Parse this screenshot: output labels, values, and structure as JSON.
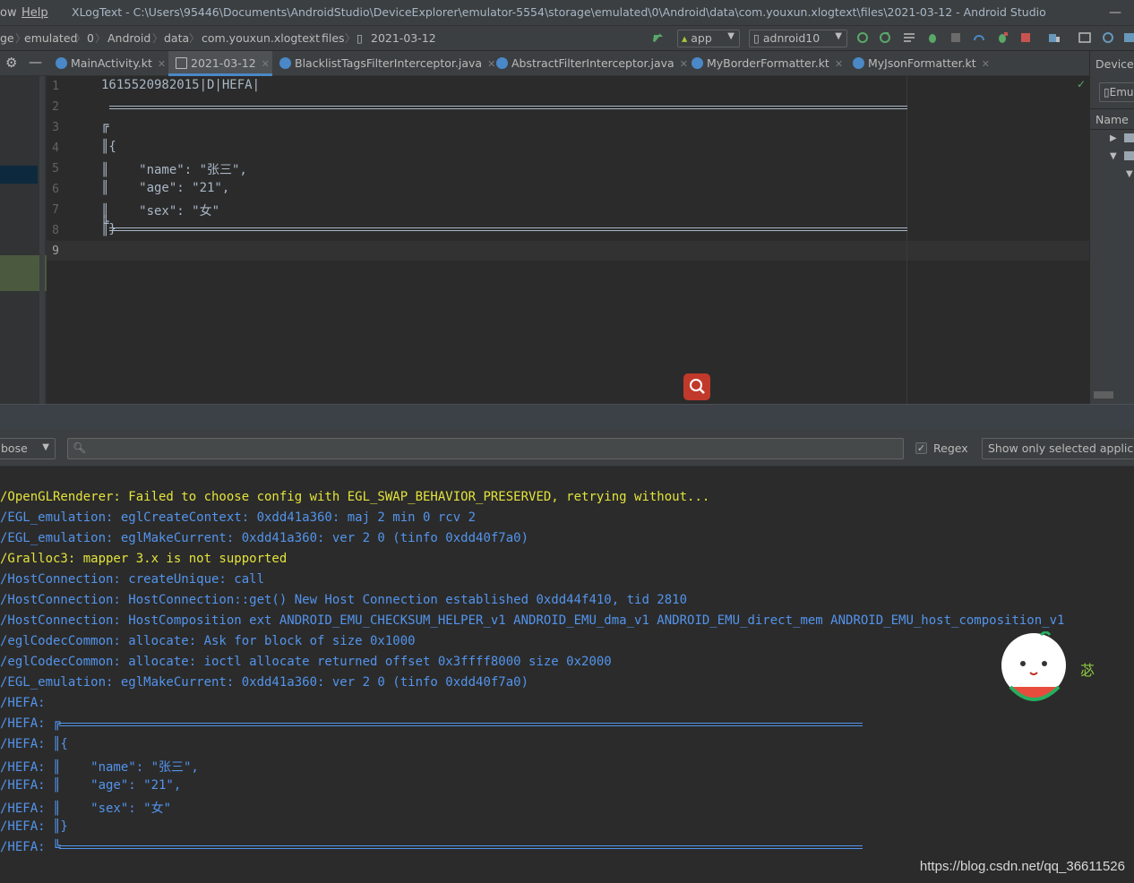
{
  "titlebar": {
    "menu_items": [
      "ow",
      "Help"
    ],
    "title": "XLogText - C:\\Users\\95446\\Documents\\AndroidStudio\\DeviceExplorer\\emulator-5554\\storage\\emulated\\0\\Android\\data\\com.youxun.xlogtext\\files\\2021-03-12 - Android Studio",
    "minimize": "—"
  },
  "breadcrumbs": [
    "ge",
    "emulated",
    "0",
    "Android",
    "data",
    "com.youxun.xlogtext",
    "files",
    "2021-03-12"
  ],
  "toolbar": {
    "run_config": "app",
    "device": "adnroid10"
  },
  "tabs": [
    {
      "label": "MainActivity.kt"
    },
    {
      "label": "2021-03-12"
    },
    {
      "label": "BlacklistTagsFilterInterceptor.java"
    },
    {
      "label": "AbstractFilterInterceptor.java"
    },
    {
      "label": "MyBorderFormatter.kt"
    },
    {
      "label": "MyJsonFormatter.kt"
    }
  ],
  "right_panel": {
    "title": "Device",
    "emu_button": "Emu",
    "column_header": "Name"
  },
  "editor": {
    "line_numbers": [
      "1",
      "2",
      "3",
      "4",
      "5",
      "6",
      "7",
      "8",
      "9"
    ],
    "lines": [
      "1615520982015|D|HEFA|",
      "",
      "╔",
      "║{",
      "║    \"name\": \"张三\",",
      "║    \"age\": \"21\",",
      "║    \"sex\": \"女\"",
      "║}",
      "╚"
    ]
  },
  "logcat": {
    "level": "bose",
    "search_placeholder": "",
    "regex_label": "Regex",
    "filter_option": "Show only selected applicati"
  },
  "log_lines": [
    {
      "text": "/OpenGLRenderer: Failed to choose config with EGL_SWAP_BEHAVIOR_PRESERVED, retrying without...",
      "level": "warn"
    },
    {
      "text": "/EGL_emulation: eglCreateContext: 0xdd41a360: maj 2 min 0 rcv 2",
      "level": "info"
    },
    {
      "text": "/EGL_emulation: eglMakeCurrent: 0xdd41a360: ver 2 0 (tinfo 0xdd40f7a0)",
      "level": "info"
    },
    {
      "text": "/Gralloc3: mapper 3.x is not supported",
      "level": "warn"
    },
    {
      "text": "/HostConnection: createUnique: call",
      "level": "info"
    },
    {
      "text": "/HostConnection: HostConnection::get() New Host Connection established 0xdd44f410, tid 2810",
      "level": "info"
    },
    {
      "text": "/HostConnection: HostComposition ext ANDROID_EMU_CHECKSUM_HELPER_v1 ANDROID_EMU_dma_v1 ANDROID_EMU_direct_mem ANDROID_EMU_host_composition_v1",
      "level": "info"
    },
    {
      "text": "/eglCodecCommon: allocate: Ask for block of size 0x1000",
      "level": "info"
    },
    {
      "text": "/eglCodecCommon: allocate: ioctl allocate returned offset 0x3ffff8000 size 0x2000",
      "level": "info"
    },
    {
      "text": "/EGL_emulation: eglMakeCurrent: 0xdd41a360: ver 2 0 (tinfo 0xdd40f7a0)",
      "level": "info"
    },
    {
      "text": "/HEFA:",
      "level": "info"
    },
    {
      "text": "/HEFA: ╔",
      "level": "info"
    },
    {
      "text": "/HEFA: ║{",
      "level": "info"
    },
    {
      "text": "/HEFA: ║    \"name\": \"张三\",",
      "level": "info"
    },
    {
      "text": "/HEFA: ║    \"age\": \"21\",",
      "level": "info"
    },
    {
      "text": "/HEFA: ║    \"sex\": \"女\"",
      "level": "info"
    },
    {
      "text": "/HEFA: ║}",
      "level": "info"
    },
    {
      "text": "/HEFA: ╚",
      "level": "info"
    }
  ],
  "sticker_glyph": "苾",
  "watermark": "https://blog.csdn.net/qq_36611526",
  "colors": {
    "accent": "#4a88c7",
    "warn": "#e3e33c",
    "info": "#5394ec",
    "search_button": "#c0392b"
  }
}
